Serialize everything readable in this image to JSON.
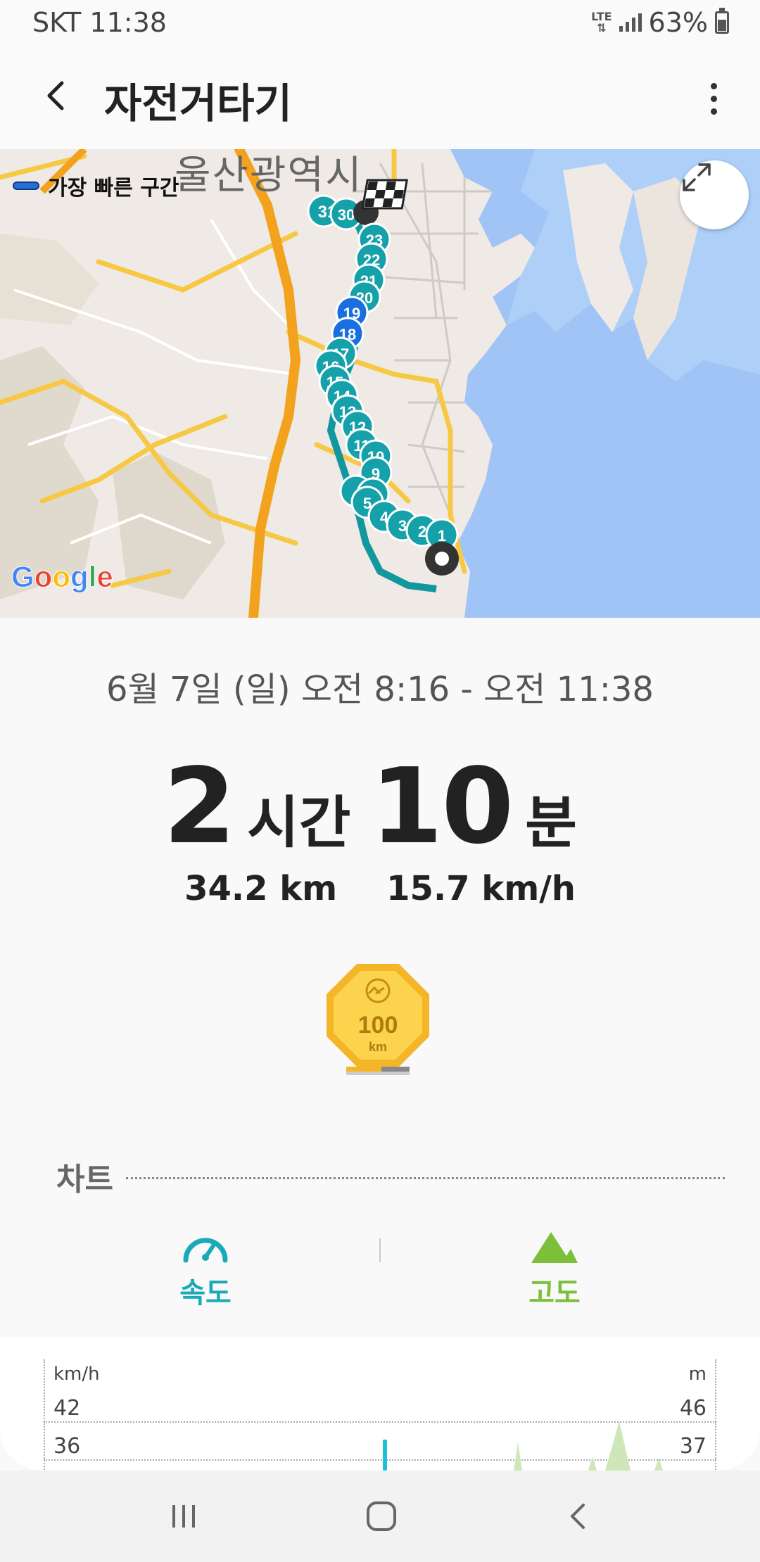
{
  "status": {
    "carrier": "SKT",
    "time": "11:38",
    "network": "LTE",
    "battery": "63%"
  },
  "header": {
    "title": "자전거타기"
  },
  "map": {
    "legend_label": "가장 빠른 구간",
    "city_label": "울산광역시",
    "google_logo": "Google",
    "route_markers": [
      "31",
      "30",
      "23",
      "22",
      "21",
      "20",
      "19",
      "18",
      "17",
      "16",
      "15",
      "14",
      "13",
      "12",
      "11",
      "10",
      "9",
      "5",
      "4",
      "3",
      "2",
      "1"
    ],
    "route_color": "#15a1a9",
    "fastest_color": "#1a6fe0"
  },
  "workout": {
    "date_range": "6월 7일 (일) 오전 8:16 - 오전 11:38",
    "duration_hours": "2",
    "duration_hours_unit": "시간",
    "duration_minutes": "10",
    "duration_minutes_unit": "분",
    "distance": "34.2 km",
    "avg_speed": "15.7 km/h"
  },
  "badge": {
    "value": "100",
    "unit": "km"
  },
  "chart_section": {
    "title": "차트",
    "tabs": [
      {
        "label": "속도",
        "color": "#1aa9b8"
      },
      {
        "label": "고도",
        "color": "#7cbf3a"
      }
    ],
    "left_unit": "km/h",
    "right_unit": "m",
    "left_ticks": [
      "42",
      "36"
    ],
    "right_ticks": [
      "46",
      "37"
    ]
  }
}
